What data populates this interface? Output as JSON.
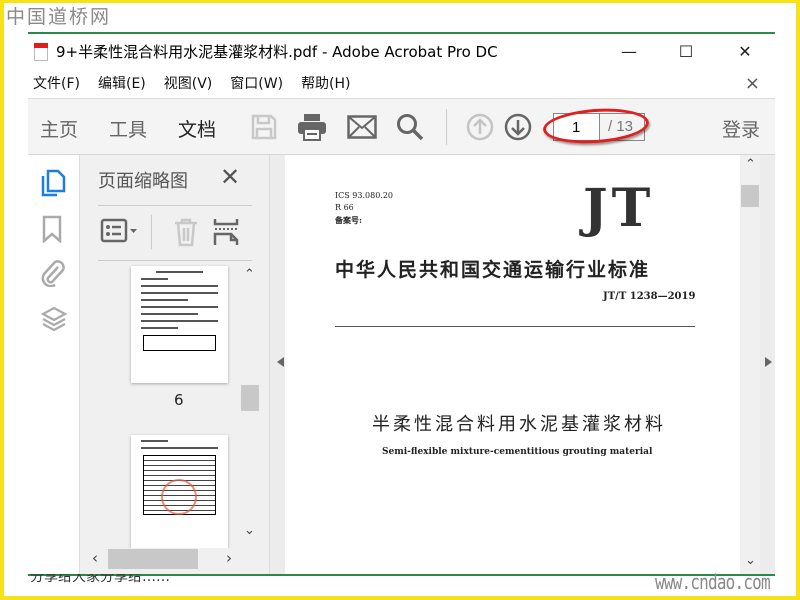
{
  "watermark": "中国道桥网",
  "window": {
    "title": "9+半柔性混合料用水泥基灌浆材料.pdf - Adobe Acrobat Pro DC",
    "minimize": "—",
    "maximize": "☐",
    "close": "✕"
  },
  "menu": [
    "文件(F)",
    "编辑(E)",
    "视图(V)",
    "窗口(W)",
    "帮助(H)"
  ],
  "menu_close": "×",
  "toolbar": {
    "tabs": [
      "主页",
      "工具",
      "文档"
    ],
    "active_tab": "文档",
    "current_page": "1",
    "total_pages": "/ 13",
    "login": "登录"
  },
  "thumbnails": {
    "title": "页面缩略图",
    "close": "✕",
    "pages": [
      "6"
    ]
  },
  "document": {
    "ics": "ICS 93.080.20",
    "r": "R 66",
    "record": "备案号:",
    "logo": "JT",
    "org": "中华人民共和国交通运输行业标准",
    "code": "JT/T 1238—2019",
    "title_cn": "半柔性混合料用水泥基灌浆材料",
    "title_en": "Semi-flexible mixture-cementitious grouting material"
  },
  "footer": {
    "caption": "分享给大家分享给……",
    "site": "www.cndao.com"
  },
  "colors": {
    "accent": "#1a7fe0",
    "highlight": "#e0201c",
    "border": "#f7e21a",
    "line": "#2a8a4a"
  }
}
